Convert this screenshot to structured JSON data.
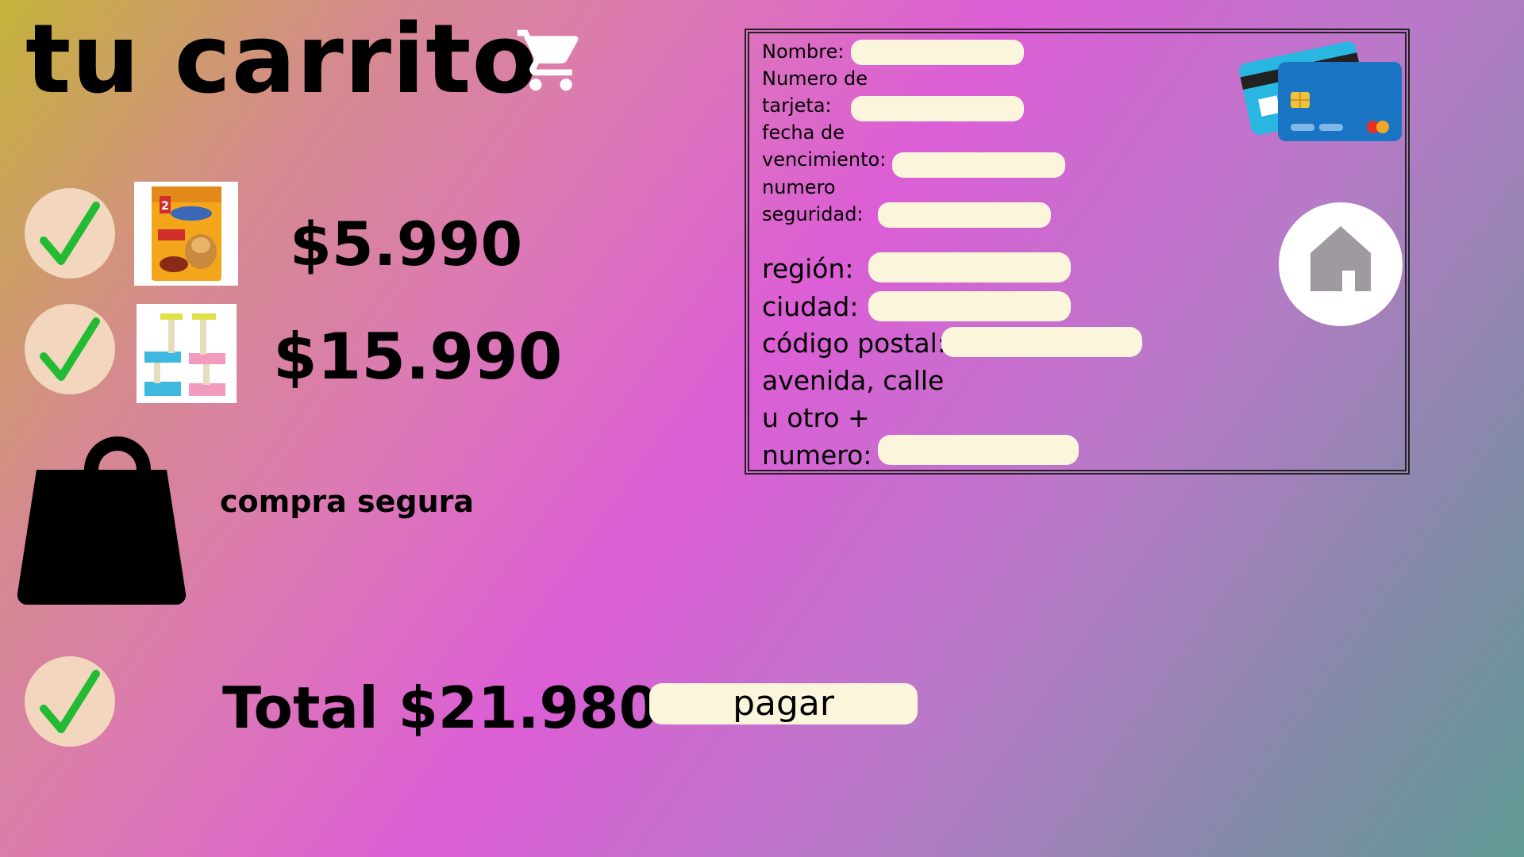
{
  "page": {
    "title": "tu carrito",
    "icons": {
      "cart": "shopping-cart-icon",
      "check": "check-icon",
      "bag": "shopping-bag-icon",
      "home": "home-icon",
      "cards": "credit-cards-icon"
    }
  },
  "cart": {
    "items": [
      {
        "image": "dog-food-bag-image",
        "price": "$5.990"
      },
      {
        "image": "cat-scratching-post-image",
        "price": "$15.990"
      }
    ],
    "secure_label": "compra segura",
    "total_label": "Total $21.980",
    "pay_button": "pagar"
  },
  "form": {
    "name_label": "Nombre:",
    "card_number_label_1": "Numero de",
    "card_number_label_2": "tarjeta:",
    "expiry_label_1": "fecha de",
    "expiry_label_2": "vencimiento:",
    "security_label_1": "numero",
    "security_label_2": "seguridad:",
    "region_label": "región:",
    "city_label": "ciudad:",
    "postal_label": "código postal:",
    "street_label_1": "avenida, calle",
    "street_label_2": "u otro +",
    "street_label_3": "numero:",
    "values": {
      "name": "",
      "card_number": "",
      "expiry": "",
      "security": "",
      "region": "",
      "city": "",
      "postal": "",
      "street": ""
    }
  },
  "colors": {
    "field_bg": "#fbf5dc",
    "check_bg": "#f2d7be",
    "check_mark": "#22bb33"
  }
}
